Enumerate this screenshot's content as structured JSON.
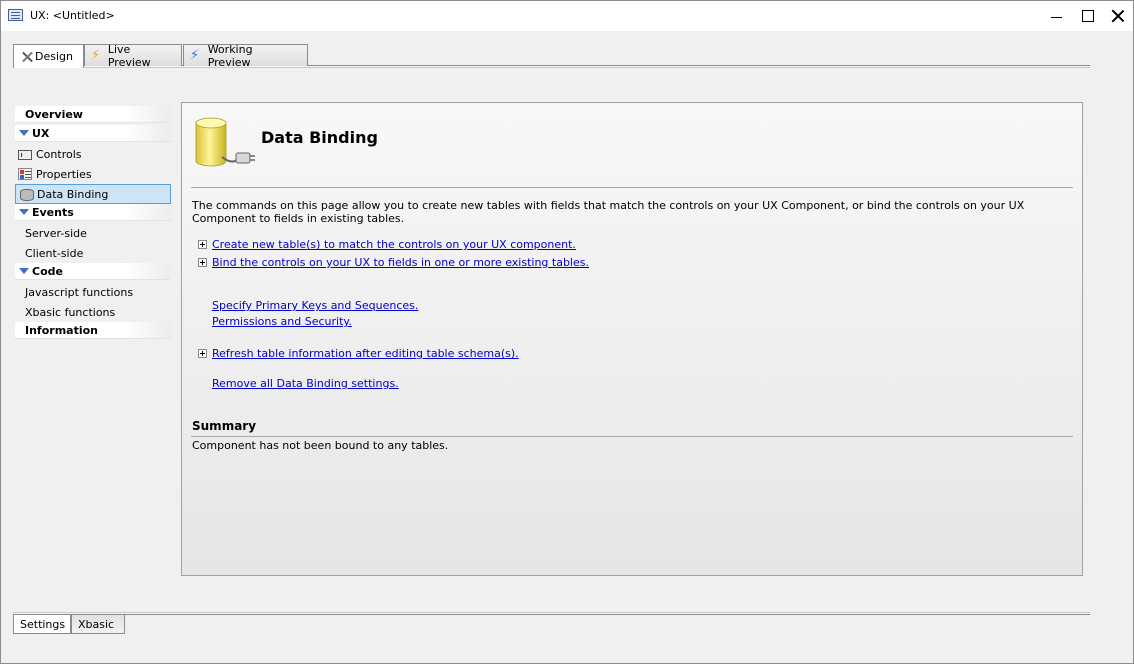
{
  "window": {
    "title": "UX: <Untitled>"
  },
  "top_tabs": [
    {
      "label": "Design",
      "icon": "design-icon",
      "active": true
    },
    {
      "label": "Live Preview",
      "icon": "lightning-icon"
    },
    {
      "label": "Working Preview",
      "icon": "lightning-blue-icon"
    }
  ],
  "nav": {
    "overview": "Overview",
    "ux": "UX",
    "controls": "Controls",
    "properties": "Properties",
    "data_binding": "Data Binding",
    "events": "Events",
    "server_side": "Server-side",
    "client_side": "Client-side",
    "code": "Code",
    "javascript_functions": "Javascript functions",
    "xbasic_functions": "Xbasic functions",
    "information": "Information"
  },
  "panel": {
    "title": "Data Binding",
    "description": "The commands on this page allow you to create new tables with fields that match the controls on your UX Component, or bind the controls on your UX Component to fields in existing tables.",
    "links": {
      "create_tables": "Create new table(s) to match the controls on your UX component.",
      "bind_controls": "Bind the controls on your UX to fields in one or more existing tables.",
      "primary_keys": "Specify Primary Keys and Sequences.",
      "permissions": "Permissions and Security.",
      "refresh_info": "Refresh table information after editing table schema(s).",
      "remove_binding": "Remove all Data Binding settings."
    },
    "summary_title": "Summary",
    "summary_text": "Component has not been bound to any tables."
  },
  "bottom_tabs": [
    {
      "label": "Settings",
      "active": true
    },
    {
      "label": "Xbasic"
    }
  ],
  "colors": {
    "link": "#0000cc",
    "selection_bg": "#cde4f7",
    "selection_border": "#5aa0d8",
    "nav_arrow": "#4070c0"
  }
}
